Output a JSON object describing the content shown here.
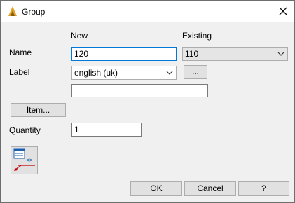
{
  "window": {
    "title": "Group",
    "close_icon": "close-icon",
    "app_icon": "app-logo-icon"
  },
  "form": {
    "col_new": "New",
    "col_existing": "Existing",
    "name_label": "Name",
    "name_value": "120",
    "existing_value": "110",
    "label_label": "Label",
    "label_language": "english (uk)",
    "ellipsis_button": "...",
    "label_text_value": "",
    "item_button": "Item...",
    "quantity_label": "Quantity",
    "quantity_value": "1",
    "tool_button_more": "..."
  },
  "footer": {
    "ok": "OK",
    "cancel": "Cancel",
    "help": "?"
  },
  "colors": {
    "accent": "#0078d7",
    "logo": "#e0a020"
  }
}
